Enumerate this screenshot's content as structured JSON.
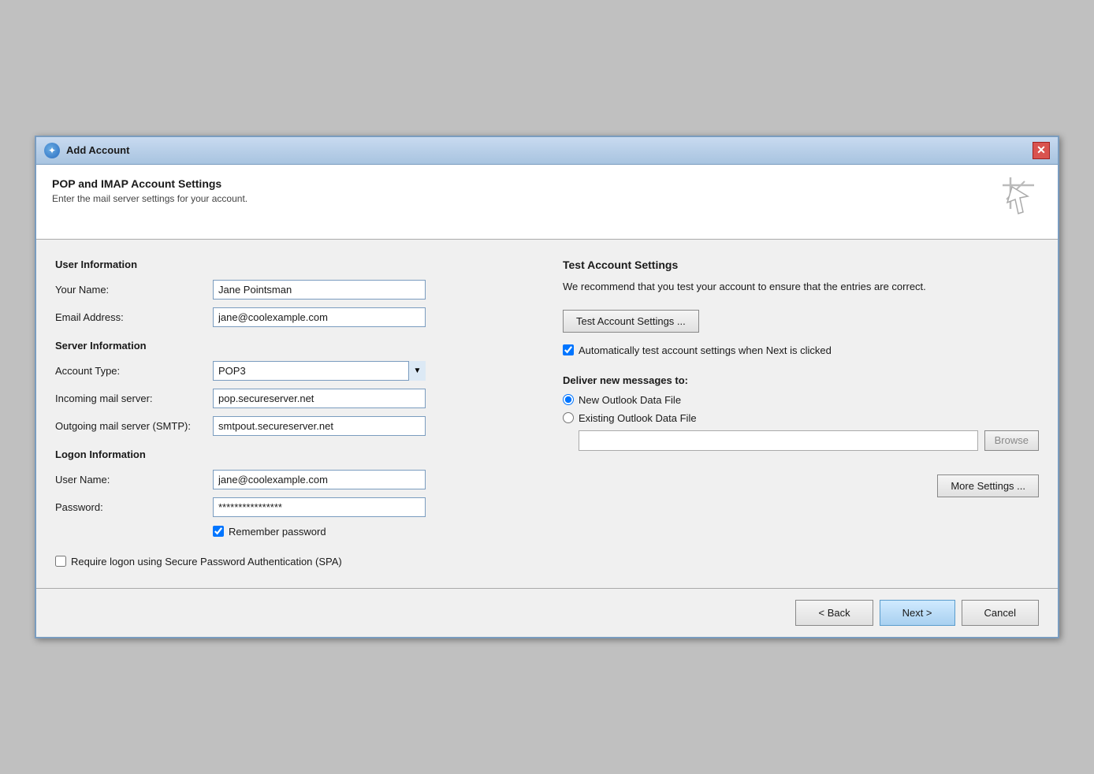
{
  "window": {
    "title": "Add Account",
    "close_label": "✕"
  },
  "header": {
    "title": "POP and IMAP Account Settings",
    "subtitle": "Enter the mail server settings for your account."
  },
  "left": {
    "user_info_title": "User Information",
    "your_name_label": "Your Name:",
    "your_name_value": "Jane Pointsman",
    "email_address_label": "Email Address:",
    "email_address_value": "jane@coolexample.com",
    "server_info_title": "Server Information",
    "account_type_label": "Account Type:",
    "account_type_value": "POP3",
    "incoming_label": "Incoming mail server:",
    "incoming_value": "pop.secureserver.net",
    "outgoing_label": "Outgoing mail server (SMTP):",
    "outgoing_value": "smtpout.secureserver.net",
    "logon_info_title": "Logon Information",
    "username_label": "User Name:",
    "username_value": "jane@coolexample.com",
    "password_label": "Password:",
    "password_value": "****************",
    "remember_password_label": "Remember password",
    "spa_label": "Require logon using Secure Password Authentication (SPA)"
  },
  "right": {
    "test_title": "Test Account Settings",
    "test_description": "We recommend that you test your account to ensure that the entries are correct.",
    "test_button_label": "Test Account Settings ...",
    "auto_test_label": "Automatically test account settings when Next is clicked",
    "deliver_title": "Deliver new messages to:",
    "radio_new_label": "New Outlook Data File",
    "radio_existing_label": "Existing Outlook Data File",
    "browse_label": "Browse",
    "more_settings_label": "More Settings ..."
  },
  "footer": {
    "back_label": "< Back",
    "next_label": "Next >",
    "cancel_label": "Cancel"
  }
}
